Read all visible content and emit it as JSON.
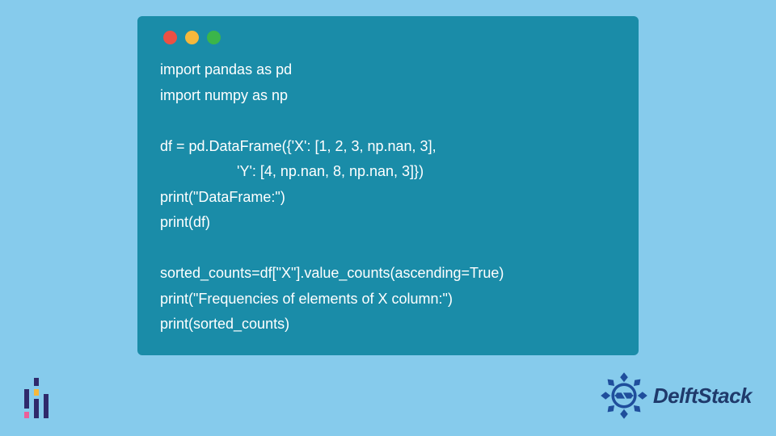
{
  "code": {
    "lines": [
      "import pandas as pd",
      "import numpy as np",
      "",
      "df = pd.DataFrame({'X': [1, 2, 3, np.nan, 3],",
      "                   'Y': [4, np.nan, 8, np.nan, 3]})",
      "print(\"DataFrame:\")",
      "print(df)",
      "",
      "sorted_counts=df[\"X\"].value_counts(ascending=True)",
      "print(\"Frequencies of elements of X column:\")",
      "print(sorted_counts)"
    ]
  },
  "brand": {
    "name": "DelftStack"
  }
}
